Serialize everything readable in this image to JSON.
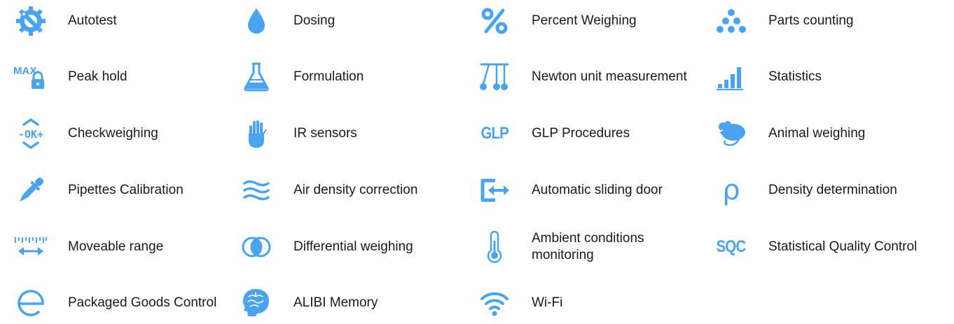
{
  "accent_color": "#4aa3f0",
  "features": [
    {
      "label": "Autotest",
      "icon": "gear-wrench-icon"
    },
    {
      "label": "Dosing",
      "icon": "drop-icon"
    },
    {
      "label": "Percent Weighing",
      "icon": "percent-icon"
    },
    {
      "label": "Parts counting",
      "icon": "dots-pyramid-icon"
    },
    {
      "label": "Peak hold",
      "icon": "max-lock-icon"
    },
    {
      "label": "Formulation",
      "icon": "flask-icon"
    },
    {
      "label": "Newton unit measurement",
      "icon": "newton-cradle-icon"
    },
    {
      "label": "Statistics",
      "icon": "bar-chart-icon"
    },
    {
      "label": "Checkweighing",
      "icon": "ok-plus-minus-icon"
    },
    {
      "label": "IR sensors",
      "icon": "hand-icon"
    },
    {
      "label": "GLP Procedures",
      "icon": "glp-icon",
      "icon_text": "GLP"
    },
    {
      "label": "Animal weighing",
      "icon": "mouse-icon"
    },
    {
      "label": "Pipettes Calibration",
      "icon": "pipette-icon"
    },
    {
      "label": "Air density correction",
      "icon": "waves-icon"
    },
    {
      "label": "Automatic sliding door",
      "icon": "door-arrow-icon"
    },
    {
      "label": "Density determination",
      "icon": "rho-icon",
      "icon_text": "ρ"
    },
    {
      "label": "Moveable range",
      "icon": "ruler-arrow-icon"
    },
    {
      "label": "Differential weighing",
      "icon": "overlap-circles-icon"
    },
    {
      "label": "Ambient conditions monitoring",
      "icon": "thermometer-icon"
    },
    {
      "label": "Statistical Quality Control",
      "icon": "sqc-icon",
      "icon_text": "SQC"
    },
    {
      "label": "Packaged Goods Control",
      "icon": "estimated-e-icon",
      "icon_text": "e"
    },
    {
      "label": "ALIBI Memory",
      "icon": "brain-head-icon"
    },
    {
      "label": "Wi-Fi",
      "icon": "wifi-icon"
    }
  ],
  "max_label": "MAX",
  "ok_label": "-OK+"
}
